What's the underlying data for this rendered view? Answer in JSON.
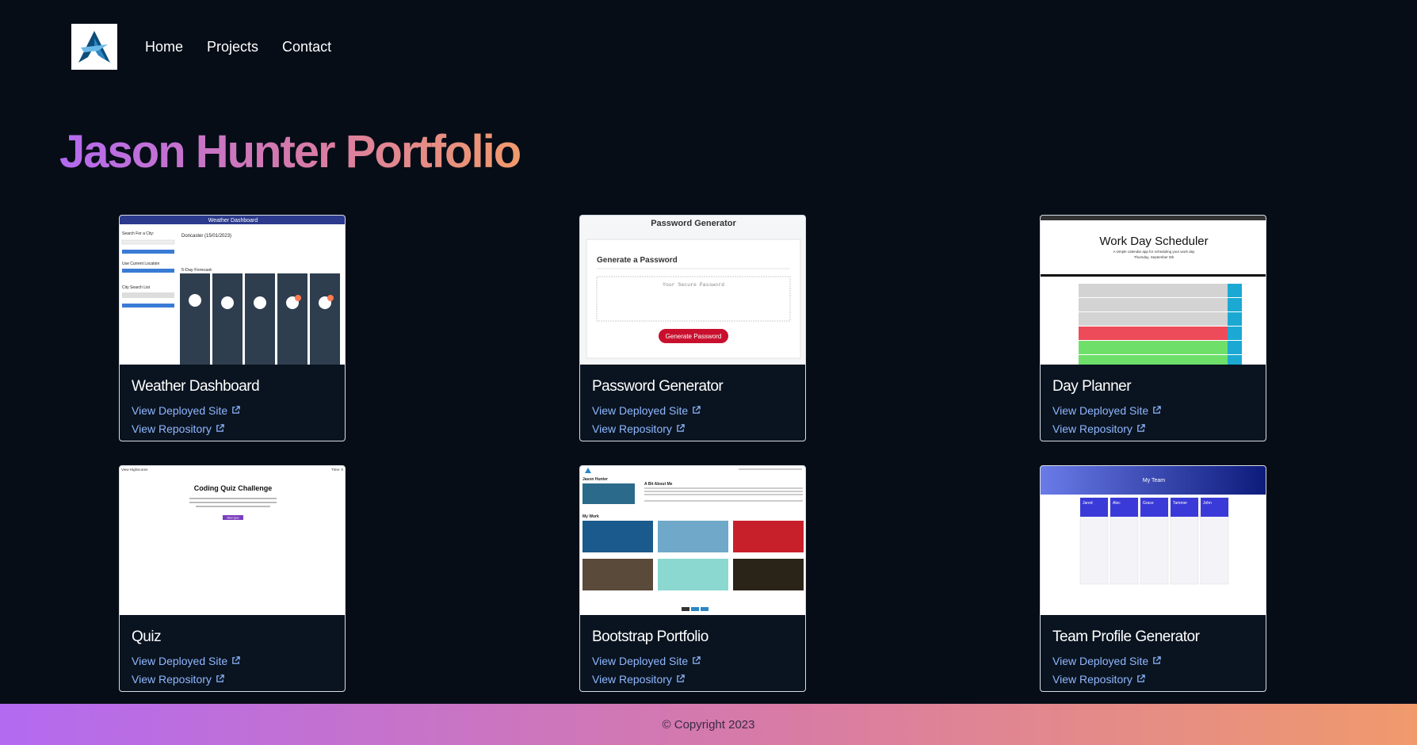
{
  "nav": {
    "logo": "logo-icon",
    "links": [
      {
        "label": "Home"
      },
      {
        "label": "Projects"
      },
      {
        "label": "Contact"
      }
    ]
  },
  "page_title": "Jason Hunter Portfolio",
  "projects": [
    {
      "title": "Weather Dashboard",
      "deployed_label": "View Deployed Site",
      "repo_label": "View Repository",
      "thumb": {
        "header": "Weather Dashboard",
        "search": "Search For a City:",
        "city": "Doncaster (15/01/2023)",
        "current": "Use Current Location",
        "list": "City Search List",
        "forecast": "5-Day Forecast:"
      }
    },
    {
      "title": "Password Generator",
      "deployed_label": "View Deployed Site",
      "repo_label": "View Repository",
      "thumb": {
        "header": "Password Generator",
        "sub": "Generate a Password",
        "placeholder": "Your Secure Password",
        "button": "Generate Password"
      }
    },
    {
      "title": "Day Planner",
      "deployed_label": "View Deployed Site",
      "repo_label": "View Repository",
      "thumb": {
        "header": "Work Day Scheduler",
        "sub": "A simple calendar app for scheduling your work day",
        "date": "Thursday, September 5th"
      }
    },
    {
      "title": "Quiz",
      "deployed_label": "View Deployed Site",
      "repo_label": "View Repository",
      "thumb": {
        "left": "View Highscores",
        "right": "Time: 0",
        "header": "Coding Quiz Challenge",
        "button": "Start Quiz"
      }
    },
    {
      "title": "Bootstrap Portfolio",
      "deployed_label": "View Deployed Site",
      "repo_label": "View Repository",
      "thumb": {
        "about": "Jason Hunter",
        "me": "A Bit About Me",
        "work": "My Work"
      }
    },
    {
      "title": "Team Profile Generator",
      "deployed_label": "View Deployed Site",
      "repo_label": "View Repository",
      "thumb": {
        "header": "My Team",
        "members": [
          "Jared",
          "Alec",
          "Grace",
          "Tammer",
          "John"
        ]
      }
    }
  ],
  "footer": {
    "copyright": "© Copyright 2023"
  },
  "colors": {
    "background": "#060d17",
    "gradient_start": "#b36af0",
    "gradient_end": "#f09a6c",
    "link": "#8fb7ff"
  }
}
